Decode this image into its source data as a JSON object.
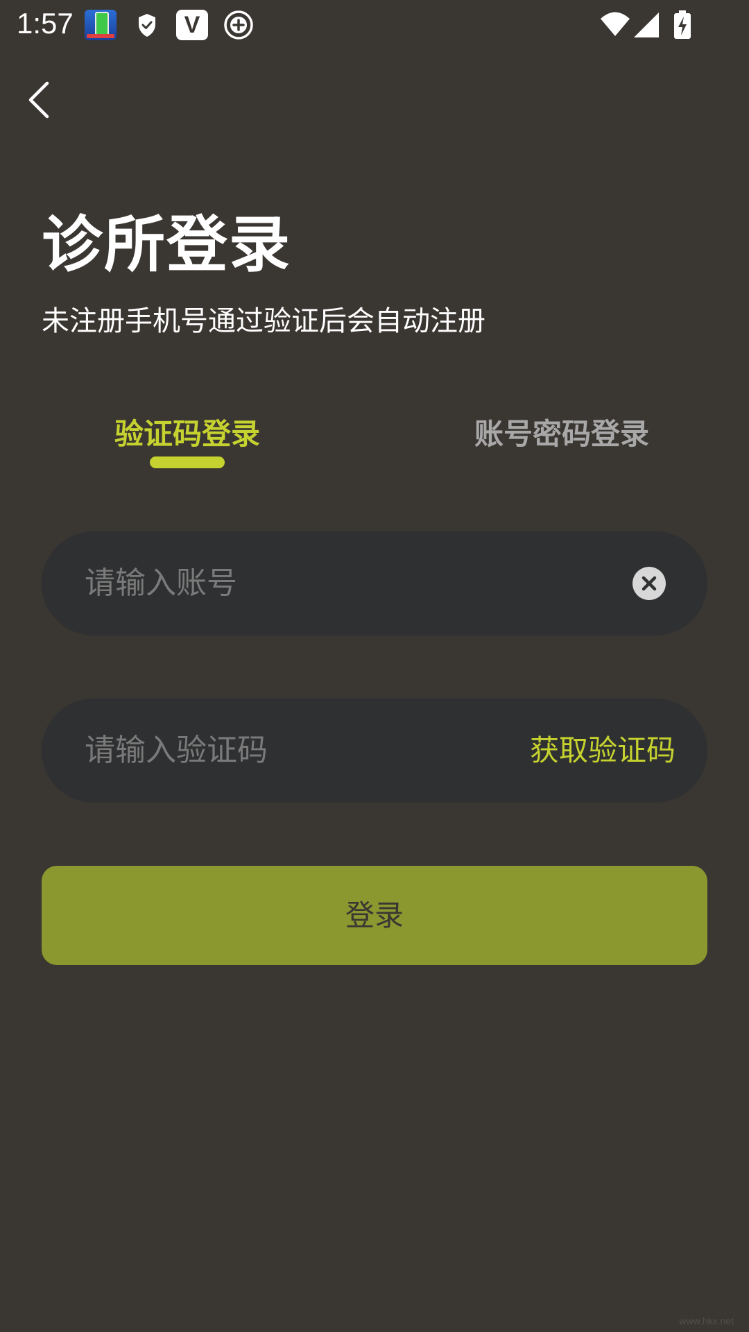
{
  "status_bar": {
    "time": "1:57",
    "icons": [
      "battery-app-icon",
      "shield-icon",
      "v-app-icon",
      "plus-circle-icon",
      "wifi-icon",
      "signal-icon",
      "battery-charging-icon"
    ],
    "v_label": "V"
  },
  "header": {
    "back_icon": "chevron-left-icon",
    "title": "诊所登录",
    "subtitle": "未注册手机号通过验证后会自动注册"
  },
  "tabs": [
    {
      "label": "验证码登录",
      "active": true
    },
    {
      "label": "账号密码登录",
      "active": false
    }
  ],
  "form": {
    "account": {
      "placeholder": "请输入账号",
      "value": ""
    },
    "code": {
      "placeholder": "请输入验证码",
      "value": ""
    },
    "get_code_label": "获取验证码",
    "submit_label": "登录"
  },
  "colors": {
    "background": "#3a3632",
    "accent": "#c5d22f",
    "input_bg": "#2f3031",
    "button_bg": "#8b9830",
    "inactive_tab": "#a8a8a8"
  },
  "watermark": "www.hkx.net"
}
